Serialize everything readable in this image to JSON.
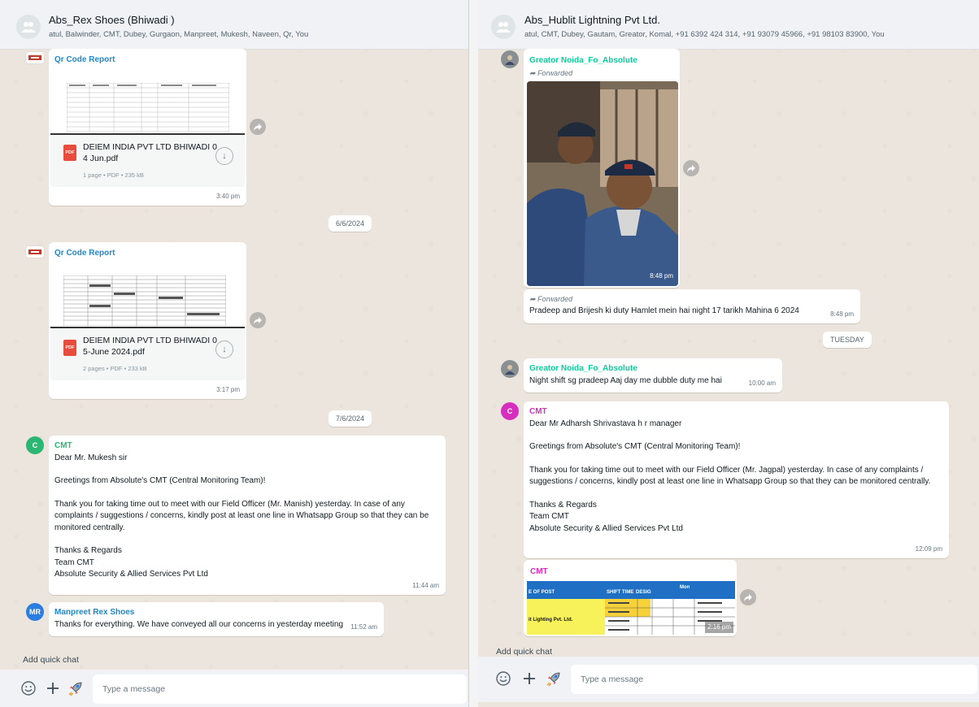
{
  "left": {
    "title": "Abs_Rex Shoes (Bhiwadi )",
    "members": "atul, Balwinder, CMT, Dubey, Gurgaon, Manpreet, Mukesh, Naveen, Qr, You",
    "doc1": {
      "sender": "Qr Code Report",
      "name_line1": "DEIEM INDIA PVT LTD BHIWADI 0",
      "name_line2": "4 Jun.pdf",
      "meta": "1 page • PDF • 235 kB",
      "time": "3:40 pm"
    },
    "date1": "6/6/2024",
    "doc2": {
      "sender": "Qr Code Report",
      "name_line1": "DEIEM INDIA PVT LTD BHIWADI 0",
      "name_line2": "5-June 2024.pdf",
      "meta": "2 pages • PDF • 233 kB",
      "time": "3:17 pm"
    },
    "date2": "7/6/2024",
    "cmt": {
      "avatar": "C",
      "sender": "CMT",
      "line1": "Dear Mr. Mukesh sir",
      "line2": "Greetings from Absolute's CMT (Central Monitoring Team)!",
      "line3": "Thank you for taking time out to meet with our Field Officer (Mr. Manish) yesterday. In case of any complaints / suggestions / concerns, kindly post at least one line in Whatsapp Group so that they can be monitored centrally.",
      "line4": "Thanks & Regards",
      "line5": "Team CMT",
      "line6": "Absolute Security & Allied Services Pvt Ltd",
      "time": "11:44 am"
    },
    "manpreet": {
      "avatar": "MR",
      "sender": "Manpreet Rex Shoes",
      "text": "Thanks for everything.  We have conveyed all our concerns in yesterday meeting",
      "time": "11:52 am"
    },
    "quick_chat": "Add quick chat",
    "input_placeholder": "Type a message"
  },
  "right": {
    "title": "Abs_Hublit Lightning Pvt Ltd.",
    "members": "atul, CMT, Dubey, Gautam, Greator, Komal, +91 6392 424 314, +91 93079 45966, +91 98103 83900, You",
    "photo_msg": {
      "sender": "Greator Noida_Fo_Absolute",
      "forwarded": "Forwarded",
      "time": "8:48 pm"
    },
    "fwd_text_msg": {
      "forwarded": "Forwarded",
      "text": "Pradeep and Brijesh ki duty Hamlet mein hai night 17 tarikh Mahina 6 2024",
      "time": "8:48 pm"
    },
    "date1": "TUESDAY",
    "night_msg": {
      "sender": "Greator Noida_Fo_Absolute",
      "text": "Night shift sg pradeep Aaj day me dubble duty me hai",
      "time": "10:00 am"
    },
    "cmt": {
      "avatar": "C",
      "sender": "CMT",
      "line1": "Dear Mr Adharsh Shrivastava h r manager",
      "line2": "Greetings from Absolute's CMT (Central Monitoring Team)!",
      "line3": "Thank you for taking time out to meet with our Field Officer (Mr. Jagpal) yesterday. In case of any complaints / suggestions / concerns, kindly post at least one line in Whatsapp Group so that they can be monitored centrally.",
      "line4": "Thanks & Regards",
      "line5": "Team CMT",
      "line6": "Absolute Security & Allied Services Pvt Ltd",
      "time": "12:09 pm"
    },
    "cmt_image": {
      "sender": "CMT",
      "col_post": "E OF POST",
      "col_shift": "SHIFT TIME",
      "col_desig": "DESIG",
      "col_mon": "Mon",
      "client": "it Lighting Pvt. Ltd.",
      "time": "2:16 pm"
    },
    "quick_chat": "Add quick chat",
    "input_placeholder": "Type a message"
  },
  "colors": {
    "teal": "#06cf9c",
    "blue_link": "#1f88c7",
    "cmt_pink": "#d62fbf",
    "cmt_avatar_left": "#2bb673",
    "cmt_avatar_right": "#d62fbf",
    "mr_avatar": "#2a7de1"
  }
}
